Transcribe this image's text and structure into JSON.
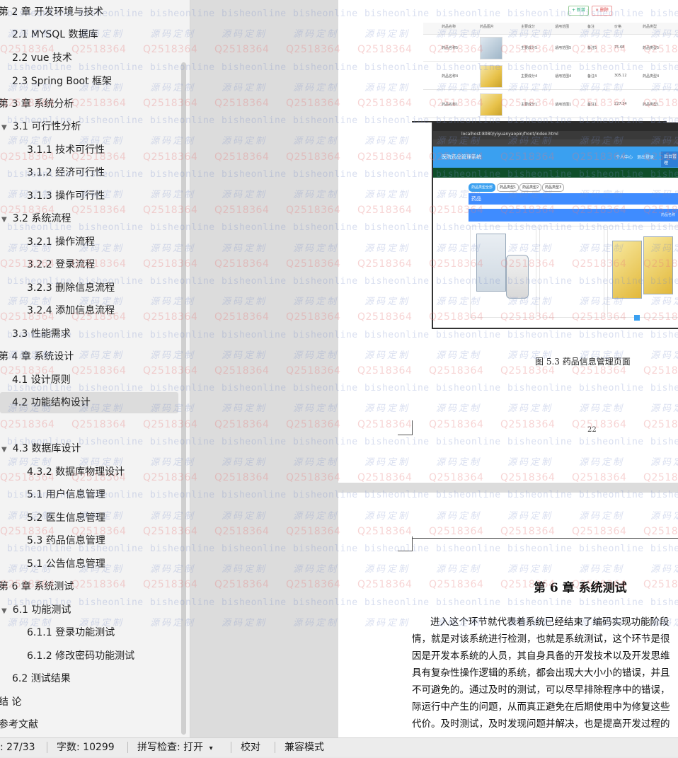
{
  "nav": {
    "items": [
      {
        "label": "第 2 章  开发环境与技术",
        "level": 0
      },
      {
        "label": "2.1 MYSQL 数据库",
        "level": 1
      },
      {
        "label": "2.2 vue 技术",
        "level": 1
      },
      {
        "label": "2.3 Spring Boot 框架",
        "level": 1
      },
      {
        "label": "第 3 章  系统分析",
        "level": 0
      },
      {
        "label": "3.1  可行性分析",
        "level": 1,
        "expanded": true
      },
      {
        "label": "3.1.1  技术可行性",
        "level": 2
      },
      {
        "label": "3.1.2  经济可行性",
        "level": 2
      },
      {
        "label": "3.1.3  操作可行性",
        "level": 2
      },
      {
        "label": "3.2  系统流程",
        "level": 1,
        "expanded": true
      },
      {
        "label": "3.2.1  操作流程",
        "level": 2
      },
      {
        "label": "3.2.2  登录流程",
        "level": 2
      },
      {
        "label": "3.2.3  删除信息流程",
        "level": 2
      },
      {
        "label": "3.2.4  添加信息流程",
        "level": 2
      },
      {
        "label": "3.3  性能需求",
        "level": 1
      },
      {
        "label": "第 4 章  系统设计",
        "level": 0
      },
      {
        "label": "4.1  设计原则",
        "level": 1
      },
      {
        "label": "4.2  功能结构设计",
        "level": 1,
        "selected": true
      },
      {
        "label": "4.3  数据库设计",
        "level": 1,
        "expanded": true
      },
      {
        "label": "4.3.2  数据库物理设计",
        "level": 2
      },
      {
        "label": "5.1 用户信息管理",
        "level": 2
      },
      {
        "label": "5.2  医生信息管理",
        "level": 2
      },
      {
        "label": "5.3  药品信息管理",
        "level": 2
      },
      {
        "label": "5.1 公告信息管理",
        "level": 2
      },
      {
        "label": "第 6 章  系统测试",
        "level": 0
      },
      {
        "label": "6.1  功能测试",
        "level": 1,
        "expanded": true
      },
      {
        "label": "6.1.1  登录功能测试",
        "level": 2
      },
      {
        "label": "6.1.2  修改密码功能测试",
        "level": 2
      },
      {
        "label": "6.2  测试结果",
        "level": 1
      },
      {
        "label": "结    论",
        "level": 0
      },
      {
        "label": "参考文献",
        "level": 0
      }
    ]
  },
  "page1": {
    "table_buttons": [
      "+ 新增",
      "× 删除"
    ],
    "table_headers": [
      "药品名称",
      "药品图片",
      "主要成分",
      "适用范围",
      "备注",
      "价格",
      "药品类型"
    ],
    "rows": [
      [
        "药品名称5",
        "",
        "主要成分5",
        "适用范围5",
        "备注5",
        "75.68",
        "药品类型5"
      ],
      [
        "药品名称4",
        "",
        "主要成分4",
        "适用范围4",
        "备注4",
        "305.12",
        "药品类型4"
      ],
      [
        "药品名称1",
        "",
        "主要成分1",
        "适用范围1",
        "备注1",
        "227.34",
        "药品类型1"
      ]
    ],
    "browser_url": "localhost:8080/yiyuanyaopin/front/index.html",
    "app_title": "医院药品管理系统",
    "app_nav": [
      "个人中心",
      "退出登录",
      "后台管理"
    ],
    "category_chips": [
      "药品类型全部",
      "药品类型1",
      "药品类型2",
      "药品类型3"
    ],
    "category_bar": "药品",
    "list_bar": "药品名称",
    "figure_caption": "图 5.3  药品信息管理页面",
    "page_number": "22"
  },
  "page2": {
    "chapter_title": "第 6 章  系统测试",
    "paragraph_lines": [
      "进入这个环节就代表着系统已经结束了编码实现功能阶段",
      "情，就是对该系统进行检测，也就是系统测试，这个环节是很",
      "因是开发本系统的人员，其自身具备的开发技术以及开发思维",
      "具有复杂性操作逻辑的系统，都会出现大大小小的错误，并且",
      "不可避免的。通过及时的测试，可以尽早排除程序中的错误，",
      "际运行中产生的问题，从而真正避免在后期使用中为修复这些",
      "代价。及时测试，及时发现问题并解决，也是提高开发过程的"
    ]
  },
  "watermark": {
    "text_a": "bisheonline",
    "text_b": "源码定制",
    "text_c": "Q2518364"
  },
  "status_bar": {
    "page": ": 27/33",
    "words": "字数: 10299",
    "spellcheck": "拼写检查: 打开",
    "proofread": "校对",
    "compat": "兼容模式"
  }
}
